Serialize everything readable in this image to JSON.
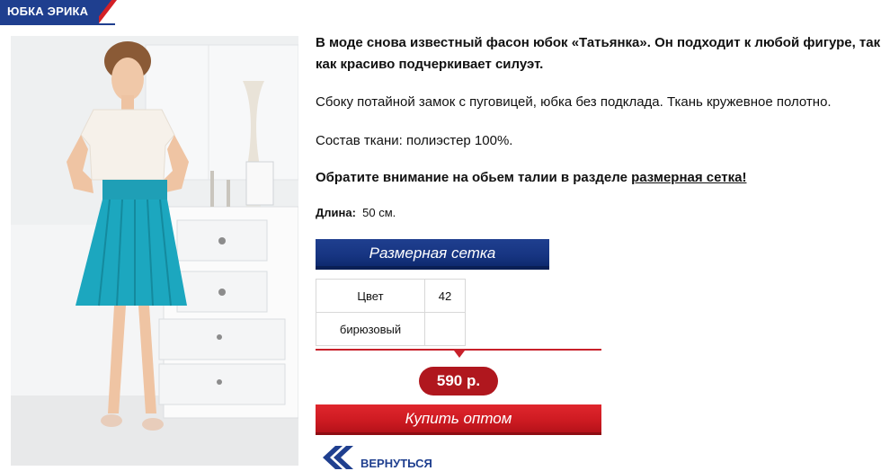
{
  "title": "ЮБКА ЭРИКА",
  "description": {
    "bold_intro": "В моде снова известный фасон юбок «Татьянка». Он подходит к любой фигуре, так как красиво подчеркивает силуэт.",
    "details": "Сбоку потайной замок с пуговицей, юбка без подклада. Ткань кружевное полотно.",
    "composition": "Состав ткани: полиэстер 100%.",
    "notice_prefix": "Обратите внимание на обьем талии в разделе ",
    "notice_link": "размерная сетка!"
  },
  "length": {
    "label": "Длина:",
    "value": "50 см."
  },
  "buttons": {
    "size_chart": "Размерная сетка",
    "buy_wholesale": "Купить оптом",
    "back": "ВЕРНУТЬСЯ"
  },
  "stock_table": {
    "header": [
      "Цвет",
      "42"
    ],
    "rows": [
      [
        "бирюзовый",
        ""
      ]
    ]
  },
  "price": "590 р.",
  "colors": {
    "brand_blue": "#1f3f8f",
    "brand_red": "#c8202a",
    "skirt_turquoise": "#1aa1b8"
  }
}
